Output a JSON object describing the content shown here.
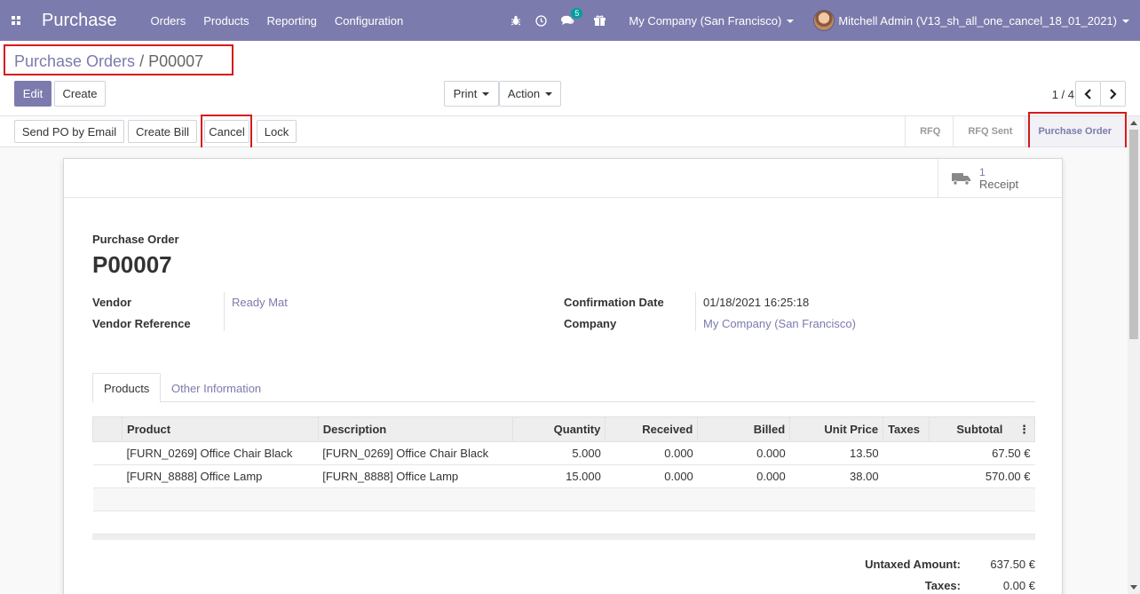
{
  "navbar": {
    "app_name": "Purchase",
    "menus": [
      "Orders",
      "Products",
      "Reporting",
      "Configuration"
    ],
    "chat_badge": "5",
    "company": "My Company (San Francisco)",
    "user": "Mitchell Admin (V13_sh_all_one_cancel_18_01_2021)",
    "bg_color": "#7c7bad"
  },
  "breadcrumb": {
    "parent": "Purchase Orders",
    "separator": " / ",
    "current": "P00007"
  },
  "toolbar": {
    "edit_label": "Edit",
    "create_label": "Create",
    "print_label": "Print",
    "action_label": "Action",
    "pager": "1 / 4"
  },
  "header_buttons": {
    "send_po": "Send PO by Email",
    "create_bill": "Create Bill",
    "cancel": "Cancel",
    "lock": "Lock"
  },
  "status": {
    "stages": [
      "RFQ",
      "RFQ Sent",
      "Purchase Order"
    ],
    "active": "Purchase Order"
  },
  "smart_button": {
    "value": "1",
    "label": "Receipt",
    "icon": "truck-icon"
  },
  "order": {
    "label": "Purchase Order",
    "name": "P00007",
    "vendor_label": "Vendor",
    "vendor": "Ready Mat",
    "vendor_ref_label": "Vendor Reference",
    "vendor_ref": "",
    "confirmation_label": "Confirmation Date",
    "confirmation_date": "01/18/2021 16:25:18",
    "company_label": "Company",
    "company": "My Company (San Francisco)"
  },
  "tabs": [
    "Products",
    "Other Information"
  ],
  "lines": {
    "headers": [
      "Product",
      "Description",
      "Quantity",
      "Received",
      "Billed",
      "Unit Price",
      "Taxes",
      "Subtotal"
    ],
    "rows": [
      {
        "product": "[FURN_0269] Office Chair Black",
        "description": "[FURN_0269] Office Chair Black",
        "quantity": "5.000",
        "received": "0.000",
        "billed": "0.000",
        "unit_price": "13.50",
        "taxes": "",
        "subtotal": "67.50 €"
      },
      {
        "product": "[FURN_8888] Office Lamp",
        "description": "[FURN_8888] Office Lamp",
        "quantity": "15.000",
        "received": "0.000",
        "billed": "0.000",
        "unit_price": "38.00",
        "taxes": "",
        "subtotal": "570.00 €"
      }
    ]
  },
  "totals": {
    "untaxed_label": "Untaxed Amount:",
    "untaxed": "637.50 €",
    "taxes_label": "Taxes:",
    "taxes": "0.00 €"
  }
}
